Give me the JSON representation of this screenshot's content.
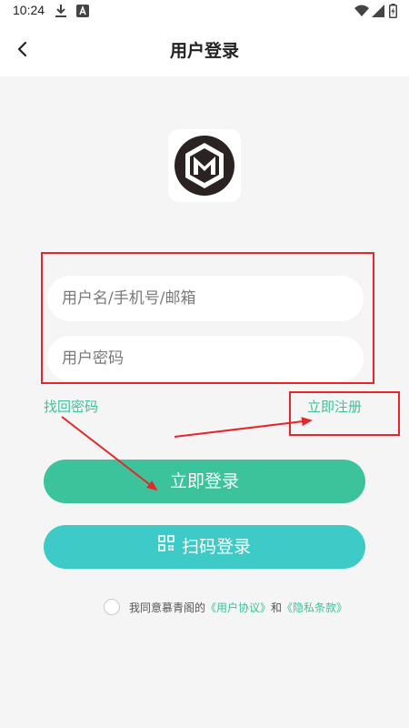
{
  "status_bar": {
    "time": "10:24",
    "icons": [
      "download-icon",
      "notification-a-icon",
      "wifi-icon",
      "signal-icon",
      "battery-icon"
    ]
  },
  "nav": {
    "title": "用户登录",
    "back_icon": "chevron-left-icon"
  },
  "logo": {
    "icon": "m-hexagon-logo"
  },
  "form": {
    "username_placeholder": "用户名/手机号/邮箱",
    "password_placeholder": "用户密码",
    "forgot_label": "找回密码",
    "register_label": "立即注册",
    "login_label": "立即登录",
    "scan_label": "扫码登录",
    "scan_icon": "qr-code-icon"
  },
  "agreement": {
    "prefix": "我同意慕青阁的",
    "user_agreement": "《用户协议》",
    "and": "和",
    "privacy_policy": "《隐私条款》"
  },
  "colors": {
    "accent_green": "#3cc39b",
    "accent_teal": "#3ecbc7",
    "annotation_red": "#e8262a",
    "background": "#f5f5f5"
  }
}
